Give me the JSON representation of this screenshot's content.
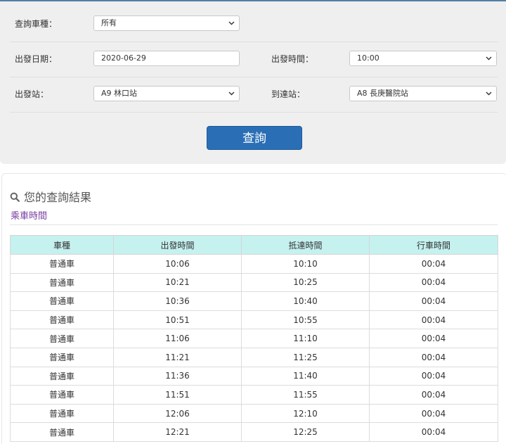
{
  "form": {
    "train_type": {
      "label": "查詢車種：",
      "value": "所有"
    },
    "depart_date": {
      "label": "出發日期：",
      "value": "2020-06-29"
    },
    "depart_time": {
      "label": "出發時間：",
      "value": "10:00"
    },
    "from_station": {
      "label": "出發站：",
      "value": "A9 林口站"
    },
    "to_station": {
      "label": "到達站：",
      "value": "A8 長庚醫院站"
    },
    "submit_label": "查詢"
  },
  "results": {
    "title": "您的查詢結果",
    "subtitle": "乘車時間",
    "columns": [
      "車種",
      "出發時間",
      "抵達時間",
      "行車時間"
    ],
    "rows": [
      [
        "普通車",
        "10:06",
        "10:10",
        "00:04"
      ],
      [
        "普通車",
        "10:21",
        "10:25",
        "00:04"
      ],
      [
        "普通車",
        "10:36",
        "10:40",
        "00:04"
      ],
      [
        "普通車",
        "10:51",
        "10:55",
        "00:04"
      ],
      [
        "普通車",
        "11:06",
        "11:10",
        "00:04"
      ],
      [
        "普通車",
        "11:21",
        "11:25",
        "00:04"
      ],
      [
        "普通車",
        "11:36",
        "11:40",
        "00:04"
      ],
      [
        "普通車",
        "11:51",
        "11:55",
        "00:04"
      ],
      [
        "普通車",
        "12:06",
        "12:10",
        "00:04"
      ],
      [
        "普通車",
        "12:21",
        "12:25",
        "00:04"
      ]
    ]
  },
  "colors": {
    "accent": "#2a6fb6",
    "header_bg": "#c5f1ef",
    "subtitle": "#7b3fa0",
    "panel_bg": "#efefef"
  }
}
